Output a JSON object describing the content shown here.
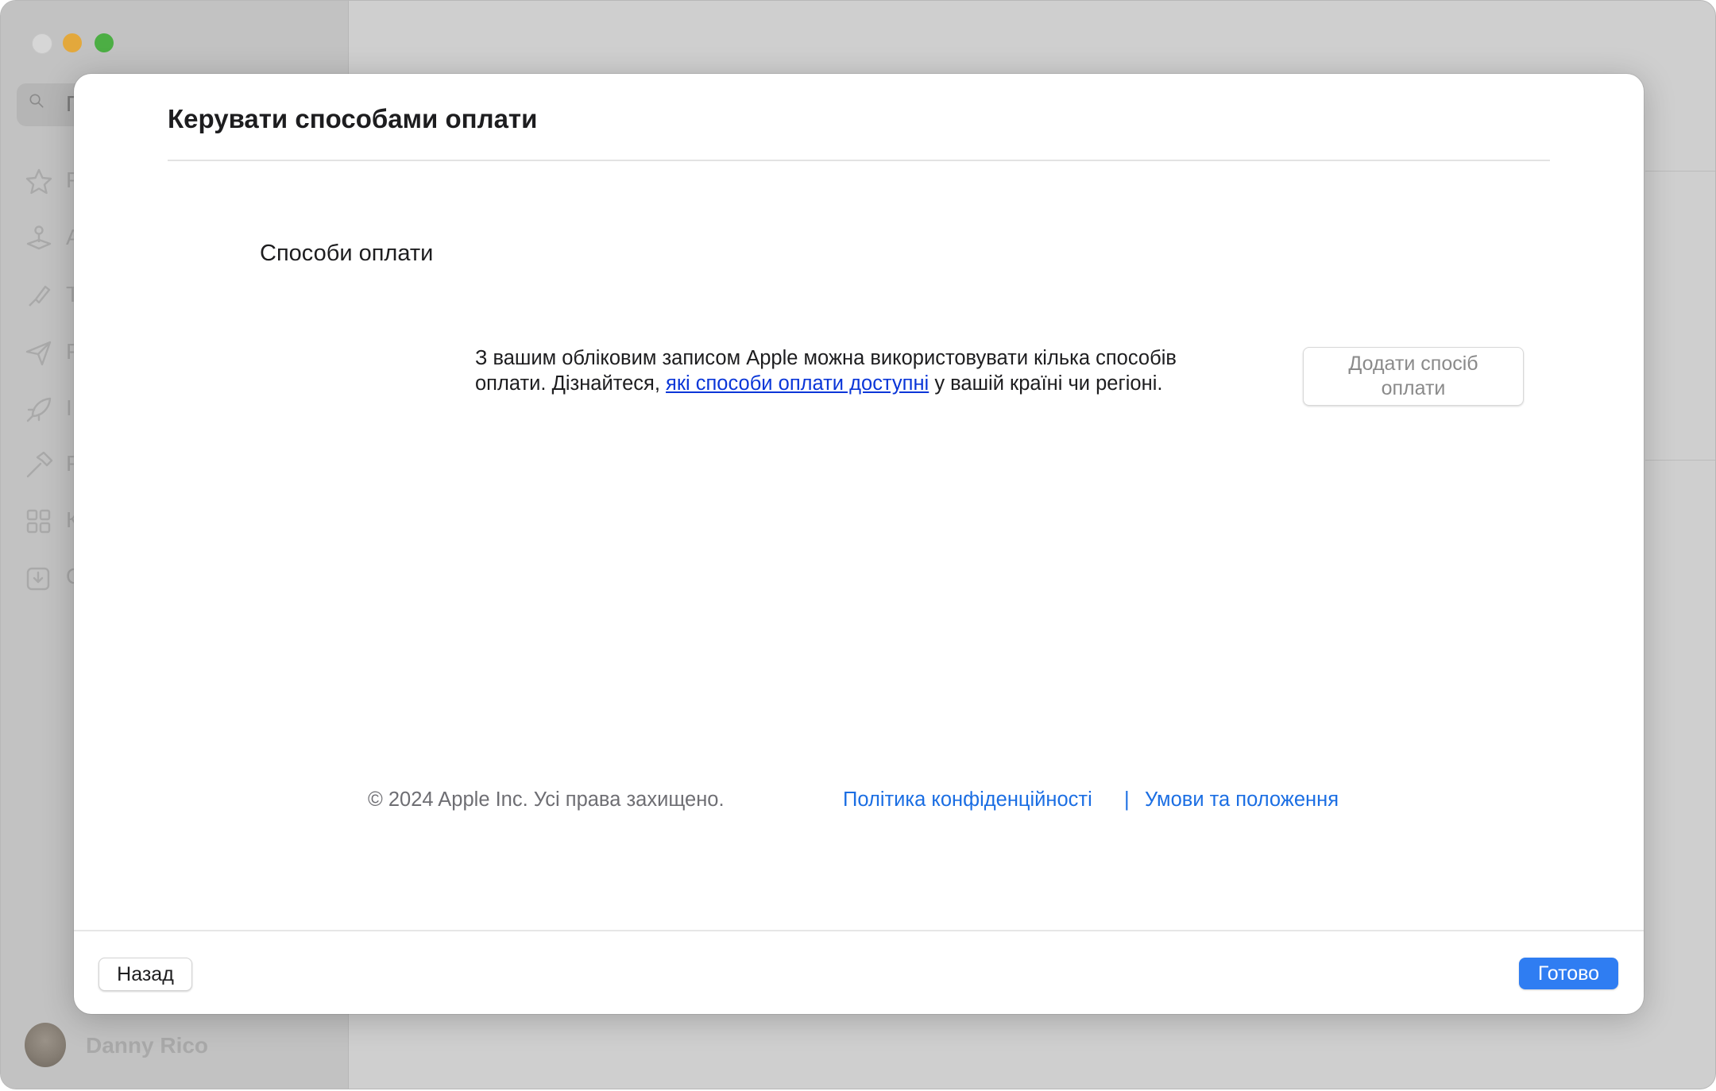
{
  "background": {
    "search_placeholder": "П",
    "sidebar_items": [
      {
        "icon": "star-icon",
        "letter": "Р"
      },
      {
        "icon": "joystick-icon",
        "letter": "А"
      },
      {
        "icon": "brush-icon",
        "letter": "Т"
      },
      {
        "icon": "paperplane-icon",
        "letter": "Р"
      },
      {
        "icon": "rocket-icon",
        "letter": "І"
      },
      {
        "icon": "hammer-icon",
        "letter": "Р"
      },
      {
        "icon": "grid-icon",
        "letter": "К"
      },
      {
        "icon": "download-icon",
        "letter": "О"
      }
    ],
    "user_name": "Danny Rico"
  },
  "sheet": {
    "title": "Керувати способами оплати",
    "section_title": "Способи оплати",
    "info": {
      "line1": "З вашим обліковим записом Apple можна використовувати кілька способів",
      "line2_before": "оплати. Дізнайтеся, ",
      "line2_link": "які способи оплати доступні",
      "line2_after": " у вашій країні чи регіоні."
    },
    "add_button": {
      "line1": "Додати спосіб",
      "line2": "оплати"
    },
    "footer": {
      "copyright": "© 2024 Apple Inc. Усі права захищено.",
      "privacy": "Політика конфіденційності",
      "separator": "|",
      "terms": "Умови та положення"
    },
    "back_button": "Назад",
    "done_button": "Готово"
  },
  "colors": {
    "accent": "#2f7df2",
    "link": "#0a36d8",
    "footer_link": "#1b6ee3"
  }
}
